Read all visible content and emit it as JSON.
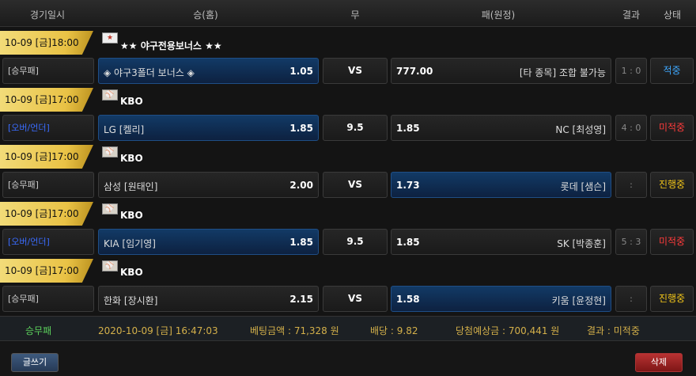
{
  "header": {
    "date": "경기일시",
    "home": "승(홈)",
    "draw": "무",
    "away": "패(원정)",
    "result": "결과",
    "status": "상태"
  },
  "games": [
    {
      "datetime": "10-09 [금]18:00",
      "league_icon": "bonus-badge-icon",
      "league": "★★ 야구전용보너스 ★★",
      "type": "[승무패]",
      "type_color": "#cccccc",
      "home": "◈ 야구3폴더 보너스 ◈",
      "home_odds": "1.05",
      "home_selected": true,
      "draw": "VS",
      "away_odds": "777.00",
      "away": "[타 종목] 조합 불가능",
      "away_selected": false,
      "score": "1 : 0",
      "status": "적중",
      "status_color": "#3ea8ff"
    },
    {
      "datetime": "10-09 [금]17:00",
      "league_icon": "baseball-icon",
      "league": "KBO",
      "type": "[오버/언더]",
      "type_color": "#3a6cff",
      "home": "LG [켈리]",
      "home_odds": "1.85",
      "home_selected": true,
      "draw": "9.5",
      "away_odds": "1.85",
      "away": "NC [최성영]",
      "away_selected": false,
      "score": "4 : 0",
      "status": "미적중",
      "status_color": "#ff3b3b"
    },
    {
      "datetime": "10-09 [금]17:00",
      "league_icon": "baseball-icon",
      "league": "KBO",
      "type": "[승무패]",
      "type_color": "#cccccc",
      "home": "삼성 [원태인]",
      "home_odds": "2.00",
      "home_selected": false,
      "draw": "VS",
      "away_odds": "1.73",
      "away": "롯데 [샘슨]",
      "away_selected": true,
      "score": ":",
      "status": "진행중",
      "status_color": "#f0c419"
    },
    {
      "datetime": "10-09 [금]17:00",
      "league_icon": "baseball-icon",
      "league": "KBO",
      "type": "[오버/언더]",
      "type_color": "#3a6cff",
      "home": "KIA [임기영]",
      "home_odds": "1.85",
      "home_selected": true,
      "draw": "9.5",
      "away_odds": "1.85",
      "away": "SK [박종훈]",
      "away_selected": false,
      "score": "5 : 3",
      "status": "미적중",
      "status_color": "#ff3b3b"
    },
    {
      "datetime": "10-09 [금]17:00",
      "league_icon": "baseball-icon",
      "league": "KBO",
      "type": "[승무패]",
      "type_color": "#cccccc",
      "home": "한화 [장시환]",
      "home_odds": "2.15",
      "home_selected": false,
      "draw": "VS",
      "away_odds": "1.58",
      "away": "키움 [윤정현]",
      "away_selected": true,
      "score": ":",
      "status": "진행중",
      "status_color": "#f0c419"
    }
  ],
  "summary": {
    "type": "승무패",
    "datetime": "2020-10-09 [금] 16:47:03",
    "bet_amount": "베팅금액 : 71,328 원",
    "odds": "배당 : 9.82",
    "expected_win": "당첨예상금 : 700,441 원",
    "result": "결과 : 미적중"
  },
  "buttons": {
    "write": "글쓰기",
    "delete": "삭제"
  },
  "colors": {
    "accent_gold": "#e9c245",
    "selected_blue": "#123a66",
    "summary_green": "#5cd15c",
    "summary_gold": "#d4b04a"
  }
}
